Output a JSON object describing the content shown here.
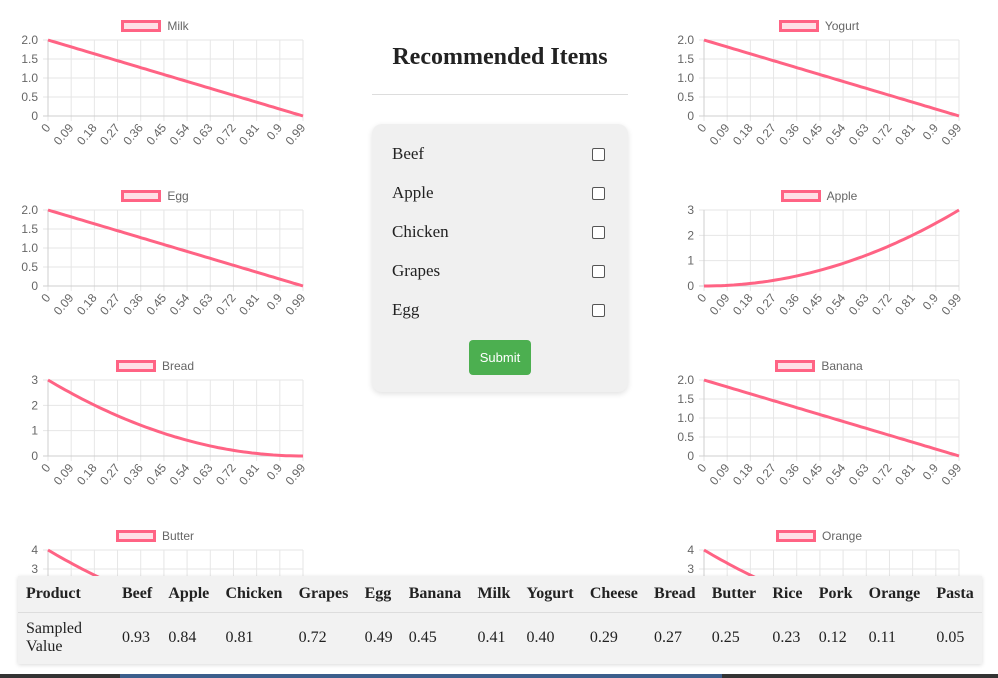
{
  "page": {
    "title": "Recommended Items",
    "submit_label": "Submit",
    "checklist": [
      "Beef",
      "Apple",
      "Chicken",
      "Grapes",
      "Egg"
    ]
  },
  "table": {
    "row_header": "Product",
    "row_label": "Sampled Value",
    "products": [
      "Beef",
      "Apple",
      "Chicken",
      "Grapes",
      "Egg",
      "Banana",
      "Milk",
      "Yogurt",
      "Cheese",
      "Bread",
      "Butter",
      "Rice",
      "Pork",
      "Orange",
      "Pasta"
    ],
    "values": [
      "0.93",
      "0.84",
      "0.81",
      "0.72",
      "0.49",
      "0.45",
      "0.41",
      "0.40",
      "0.29",
      "0.27",
      "0.25",
      "0.23",
      "0.12",
      "0.11",
      "0.05"
    ]
  },
  "colors": {
    "line": "#ff6384",
    "button": "#4caf50",
    "panel": "#f0f0f0"
  },
  "chart_data": [
    {
      "type": "line",
      "series": [
        {
          "name": "Milk",
          "kind": "linear-down",
          "max": 2
        }
      ],
      "x": [
        "0",
        "0.09",
        "0.18",
        "0.27",
        "0.36",
        "0.45",
        "0.54",
        "0.63",
        "0.72",
        "0.81",
        "0.9",
        "0.99"
      ],
      "yticks": [
        "0",
        "0.5",
        "1.0",
        "1.5",
        "2.0"
      ],
      "ylim": [
        0,
        2
      ]
    },
    {
      "type": "line",
      "series": [
        {
          "name": "Yogurt",
          "kind": "linear-down",
          "max": 2
        }
      ],
      "x": [
        "0",
        "0.09",
        "0.18",
        "0.27",
        "0.36",
        "0.45",
        "0.54",
        "0.63",
        "0.72",
        "0.81",
        "0.9",
        "0.99"
      ],
      "yticks": [
        "0",
        "0.5",
        "1.0",
        "1.5",
        "2.0"
      ],
      "ylim": [
        0,
        2
      ]
    },
    {
      "type": "line",
      "series": [
        {
          "name": "Egg",
          "kind": "linear-down",
          "max": 2
        }
      ],
      "x": [
        "0",
        "0.09",
        "0.18",
        "0.27",
        "0.36",
        "0.45",
        "0.54",
        "0.63",
        "0.72",
        "0.81",
        "0.9",
        "0.99"
      ],
      "yticks": [
        "0",
        "0.5",
        "1.0",
        "1.5",
        "2.0"
      ],
      "ylim": [
        0,
        2
      ]
    },
    {
      "type": "line",
      "series": [
        {
          "name": "Apple",
          "kind": "quad-up",
          "max": 3
        }
      ],
      "x": [
        "0",
        "0.09",
        "0.18",
        "0.27",
        "0.36",
        "0.45",
        "0.54",
        "0.63",
        "0.72",
        "0.81",
        "0.9",
        "0.99"
      ],
      "yticks": [
        "0",
        "1",
        "2",
        "3"
      ],
      "ylim": [
        0,
        3
      ]
    },
    {
      "type": "line",
      "series": [
        {
          "name": "Bread",
          "kind": "quad-down",
          "max": 3
        }
      ],
      "x": [
        "0",
        "0.09",
        "0.18",
        "0.27",
        "0.36",
        "0.45",
        "0.54",
        "0.63",
        "0.72",
        "0.81",
        "0.9",
        "0.99"
      ],
      "yticks": [
        "0",
        "1",
        "2",
        "3"
      ],
      "ylim": [
        0,
        3
      ]
    },
    {
      "type": "line",
      "series": [
        {
          "name": "Banana",
          "kind": "linear-down",
          "max": 2
        }
      ],
      "x": [
        "0",
        "0.09",
        "0.18",
        "0.27",
        "0.36",
        "0.45",
        "0.54",
        "0.63",
        "0.72",
        "0.81",
        "0.9",
        "0.99"
      ],
      "yticks": [
        "0",
        "0.5",
        "1.0",
        "1.5",
        "2.0"
      ],
      "ylim": [
        0,
        2
      ]
    },
    {
      "type": "line",
      "series": [
        {
          "name": "Butter",
          "kind": "quad-down",
          "max": 4
        }
      ],
      "x": [],
      "yticks": [
        "3",
        "4"
      ],
      "ylim": [
        0,
        4
      ]
    },
    {
      "type": "line",
      "series": [
        {
          "name": "Orange",
          "kind": "quad-down",
          "max": 4
        }
      ],
      "x": [],
      "yticks": [
        "3",
        "4"
      ],
      "ylim": [
        0,
        4
      ]
    }
  ]
}
